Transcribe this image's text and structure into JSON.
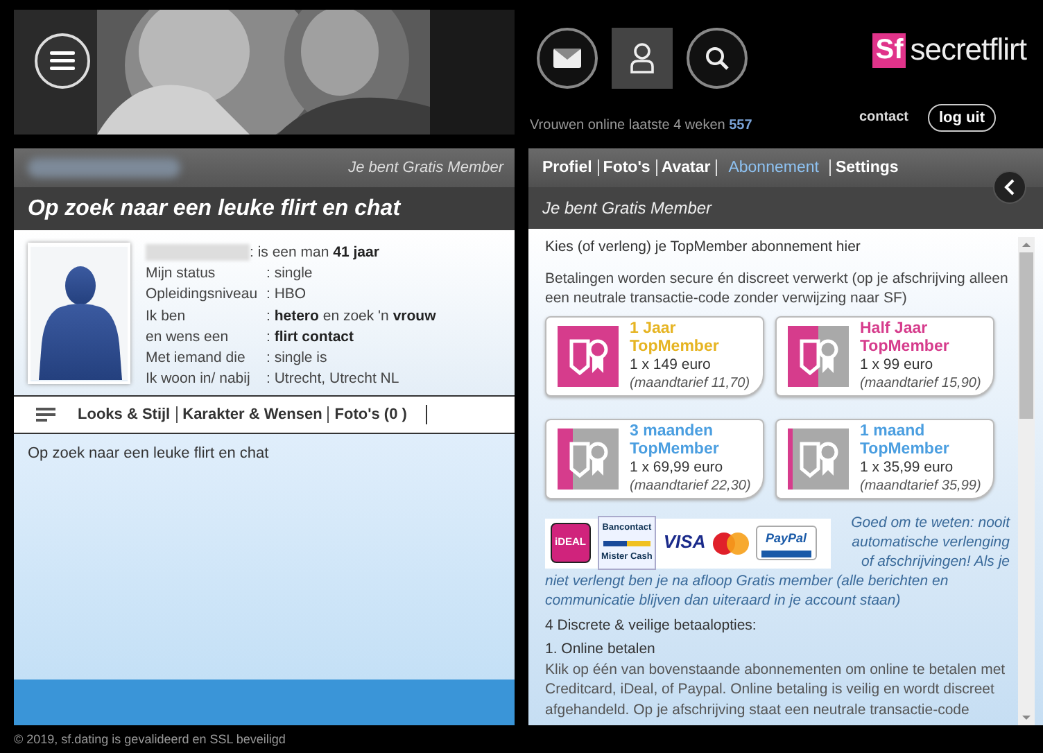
{
  "nav_icons": [
    {
      "kind": "mail",
      "selected": false
    },
    {
      "kind": "user",
      "selected": true
    },
    {
      "kind": "search",
      "selected": false
    }
  ],
  "logo": {
    "mark": "Sf",
    "name": "secretflirt"
  },
  "online": {
    "label": "Vrouwen online laatste 4 weken",
    "count": "557"
  },
  "top_links": {
    "contact": "contact",
    "logout": "log uit"
  },
  "profile": {
    "member_status": "Je bent Gratis Member",
    "title": "Op zoek naar een leuke flirt en chat",
    "rows": [
      {
        "value": ": is een man **41 jaar**"
      },
      {
        "label": "Mijn status",
        "value": ": single"
      },
      {
        "label": "Opleidingsniveau",
        "value": ": HBO"
      },
      {
        "label": "Ik ben",
        "value": ": **hetero** en zoek 'n **vrouw**"
      },
      {
        "label": "en wens een",
        "value": ": **flirt contact**"
      },
      {
        "label": "Met iemand die",
        "value": ": single is"
      },
      {
        "label": "Ik woon in/ nabij",
        "value": ": Utrecht, Utrecht NL"
      }
    ],
    "tabs": [
      {
        "label": "Looks & Stijl"
      },
      {
        "label": "Karakter & Wensen"
      },
      {
        "label": "Foto's (0 )"
      }
    ],
    "description": "Op zoek naar een leuke flirt en chat"
  },
  "footer": "© 2019, sf.dating is gevalideerd en SSL beveiligd",
  "account": {
    "nav": [
      {
        "label": "Profiel",
        "selected": false
      },
      {
        "label": "Foto's",
        "selected": false
      },
      {
        "label": "Avatar",
        "selected": false
      },
      {
        "label": "Abonnement",
        "selected": true
      },
      {
        "label": "Settings",
        "selected": false
      }
    ],
    "member_status": "Je bent Gratis Member",
    "heading": "Kies (of verleng) je TopMember abonnement hier",
    "intro": "Betalingen worden secure én discreet verwerkt (op  je afschrijving alleen een neutrale transactie-code zonder verwijzing naar SF)",
    "plans": [
      {
        "title": "1 Jaar",
        "subtitle": "TopMember",
        "price": "1 x 149 euro",
        "monthly": "(maandtarief 11,70)",
        "color": "#e6b422",
        "level": 1
      },
      {
        "title": "Half Jaar",
        "subtitle": "TopMember",
        "price": "1 x 99 euro",
        "monthly": "(maandtarief 15,90)",
        "color": "#d63c8c",
        "level": 0.5
      },
      {
        "title": "3 maanden",
        "subtitle": "TopMember",
        "price": "1 x 69,99 euro",
        "monthly": "(maandtarief 22,30)",
        "color": "#4a9ee0",
        "level": 0.25
      },
      {
        "title": "1 maand",
        "subtitle": "TopMember",
        "price": "1 x 35,99 euro",
        "monthly": "(maandtarief 35,99)",
        "color": "#4a9ee0",
        "level": 0.08
      }
    ],
    "payment_logos": [
      {
        "kind": "ideal",
        "label": "iDEAL"
      },
      {
        "kind": "bancontact",
        "label": "Bancontact",
        "sublabel": "Mister Cash"
      },
      {
        "kind": "visa",
        "label": "VISA"
      },
      {
        "kind": "mastercard"
      },
      {
        "kind": "paypal",
        "label": "PayPal"
      }
    ],
    "note": {
      "aside": "Goed om te weten: nooit automatische verlenging of afschrijvingen! Als je",
      "continued": "niet verlengt ben je na afloop Gratis member (alle berichten en communicatie blijven dan uiteraard in je account staan)"
    },
    "options_heading": "4 Discrete & veilige betaalopties:",
    "option_title": "1. Online betalen",
    "option_text": "Klik op één van bovenstaande abonnementen om online te betalen met Creditcard, iDeal, of Paypal. Online betaling is veilig en wordt discreet afgehandeld. Op je afschrijving staat een neutrale transactie-code"
  }
}
